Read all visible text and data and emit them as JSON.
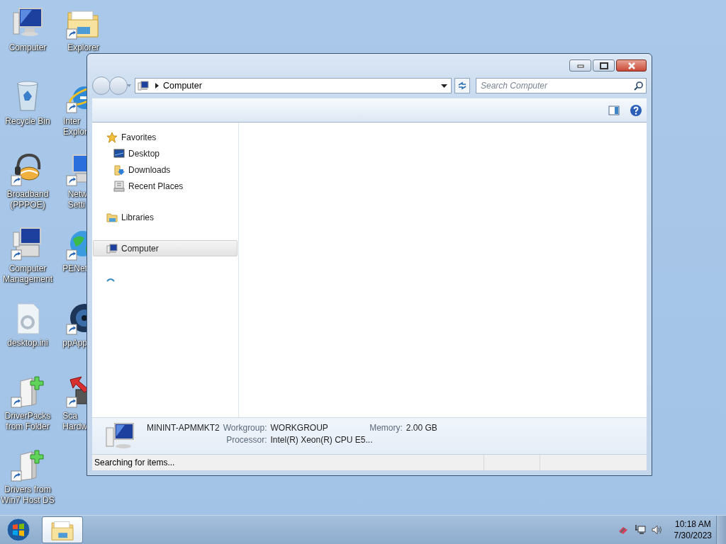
{
  "desktop_icons": [
    {
      "kind": "computer",
      "lines": [
        "Computer"
      ]
    },
    {
      "kind": "recycle",
      "lines": [
        "Recycle Bin"
      ]
    },
    {
      "kind": "headset",
      "lines": [
        "Broadband",
        "(PPPOE)"
      ]
    },
    {
      "kind": "manage",
      "lines": [
        "Computer",
        "Management"
      ]
    },
    {
      "kind": "ini",
      "lines": [
        "desktop.ini"
      ]
    },
    {
      "kind": "driver",
      "lines": [
        "DriverPacks",
        "from Folder"
      ]
    },
    {
      "kind": "driver",
      "lines": [
        "Drivers from",
        "Win7 Host DS"
      ]
    },
    {
      "kind": "folder",
      "lines": [
        "Explorer"
      ]
    },
    {
      "kind": "ie",
      "lines": [
        "Inter",
        "Explor"
      ]
    },
    {
      "kind": "network",
      "lines": [
        "Netw",
        "Setti"
      ]
    },
    {
      "kind": "globe",
      "lines": [
        "PENet"
      ]
    },
    {
      "kind": "disc",
      "lines": [
        "ppApp"
      ]
    },
    {
      "kind": "scan",
      "lines": [
        "Sca",
        "Hardw"
      ]
    }
  ],
  "window": {
    "address": {
      "path": "Computer"
    },
    "search": {
      "placeholder": "Search Computer"
    },
    "nav": [
      {
        "kind": "star",
        "label": "Favorites",
        "selected": false,
        "children": [
          {
            "kind": "desktop",
            "label": "Desktop",
            "selected": false
          },
          {
            "kind": "download",
            "label": "Downloads",
            "selected": false
          },
          {
            "kind": "recent",
            "label": "Recent Places",
            "selected": false
          }
        ]
      },
      {
        "kind": "library",
        "label": "Libraries",
        "selected": false
      },
      {
        "kind": "computer",
        "label": "Computer",
        "selected": true
      },
      {
        "kind": "loading",
        "selected": false
      }
    ],
    "details": {
      "name": "MININT-APMMKT2",
      "fields": [
        {
          "label": "Workgroup:",
          "value": "WORKGROUP"
        },
        {
          "label": "Memory:",
          "value": "2.00 GB"
        },
        {
          "label": "Processor:",
          "value": "Intel(R) Xeon(R) CPU E5..."
        }
      ]
    },
    "status_bar": {
      "text": "Searching for items..."
    }
  },
  "taskbar": {
    "buttons": [
      {
        "kind": "explorer",
        "selected": true
      }
    ],
    "clock": {
      "time": "10:18 AM",
      "date": "7/30/2023"
    }
  }
}
